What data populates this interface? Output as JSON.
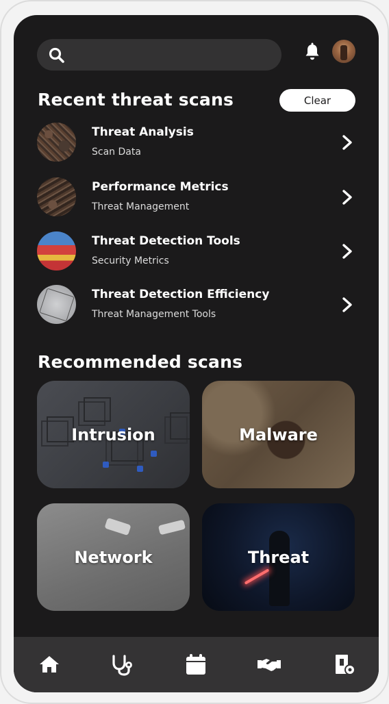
{
  "search": {
    "icon": "search-icon",
    "placeholder": ""
  },
  "header": {
    "notification_icon": "bell-icon",
    "avatar": "user-avatar"
  },
  "recent": {
    "title": "Recent threat scans",
    "clear_label": "Clear",
    "items": [
      {
        "title": "Threat Analysis",
        "subtitle": "Scan Data"
      },
      {
        "title": "Performance Metrics",
        "subtitle": "Threat Management"
      },
      {
        "title": "Threat Detection Tools",
        "subtitle": "Security Metrics"
      },
      {
        "title": "Threat Detection Efficiency",
        "subtitle": "Threat Management Tools"
      }
    ]
  },
  "recommended": {
    "title": "Recommended scans",
    "cards": [
      {
        "label": "Intrusion"
      },
      {
        "label": "Malware"
      },
      {
        "label": "Network"
      },
      {
        "label": "Threat"
      }
    ]
  },
  "nav": {
    "items": [
      {
        "icon": "home-icon"
      },
      {
        "icon": "stethoscope-icon"
      },
      {
        "icon": "calendar-icon"
      },
      {
        "icon": "handshake-icon"
      },
      {
        "icon": "settings-icon"
      }
    ]
  },
  "colors": {
    "background": "#1b1a1b",
    "surface": "#333233",
    "nav": "#343334",
    "text": "#ffffff"
  }
}
